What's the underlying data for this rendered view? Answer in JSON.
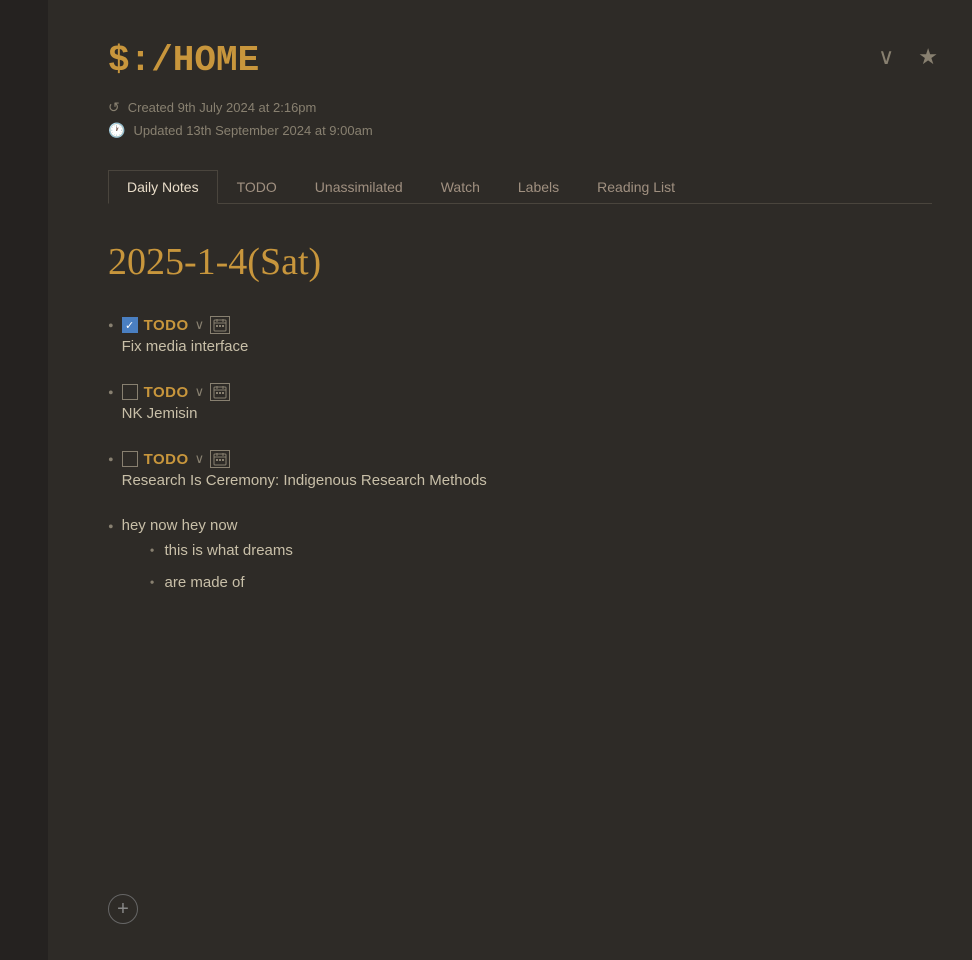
{
  "app": {
    "title": "$:/HOME",
    "created_label": "Created 9th July 2024 at 2:16pm",
    "updated_label": "Updated 13th September 2024 at 9:00am"
  },
  "header": {
    "chevron_label": "∨",
    "star_label": "★"
  },
  "tabs": [
    {
      "id": "daily-notes",
      "label": "Daily Notes",
      "active": true
    },
    {
      "id": "todo",
      "label": "TODO",
      "active": false
    },
    {
      "id": "unassimilated",
      "label": "Unassimilated",
      "active": false
    },
    {
      "id": "watch",
      "label": "Watch",
      "active": false
    },
    {
      "id": "labels",
      "label": "Labels",
      "active": false
    },
    {
      "id": "reading-list",
      "label": "Reading List",
      "active": false
    }
  ],
  "daily_notes": {
    "date_heading": "2025-1-4(Sat)",
    "items": [
      {
        "type": "todo",
        "checked": true,
        "label": "TODO",
        "text": "Fix media interface"
      },
      {
        "type": "todo",
        "checked": false,
        "label": "TODO",
        "text": "NK Jemisin"
      },
      {
        "type": "todo",
        "checked": false,
        "label": "TODO",
        "text": "Research Is Ceremony: Indigenous Research Methods"
      },
      {
        "type": "plain",
        "text": "hey now hey now",
        "sub_items": [
          "this is what dreams",
          "are made of"
        ]
      }
    ]
  },
  "add_button_label": "+"
}
